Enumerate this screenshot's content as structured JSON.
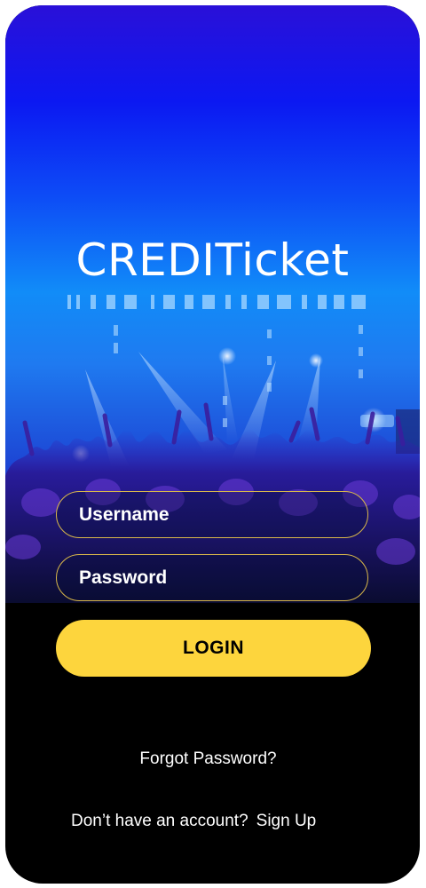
{
  "app": {
    "brand_name": "CREDITicket"
  },
  "form": {
    "username_placeholder": "Username",
    "password_placeholder": "Password",
    "login_label": "LOGIN"
  },
  "links": {
    "forgot_password": "Forgot Password?",
    "no_account_text": "Don’t have an account?",
    "signup_label": "Sign Up"
  },
  "colors": {
    "accent": "#fdd53d",
    "field_border": "#d9b84a",
    "background_top": "#2a10d8",
    "background_mid": "#118cf8",
    "bottom": "#000000",
    "text": "#ffffff"
  },
  "icons": {
    "logo_barcode": "barcode-stripe"
  }
}
